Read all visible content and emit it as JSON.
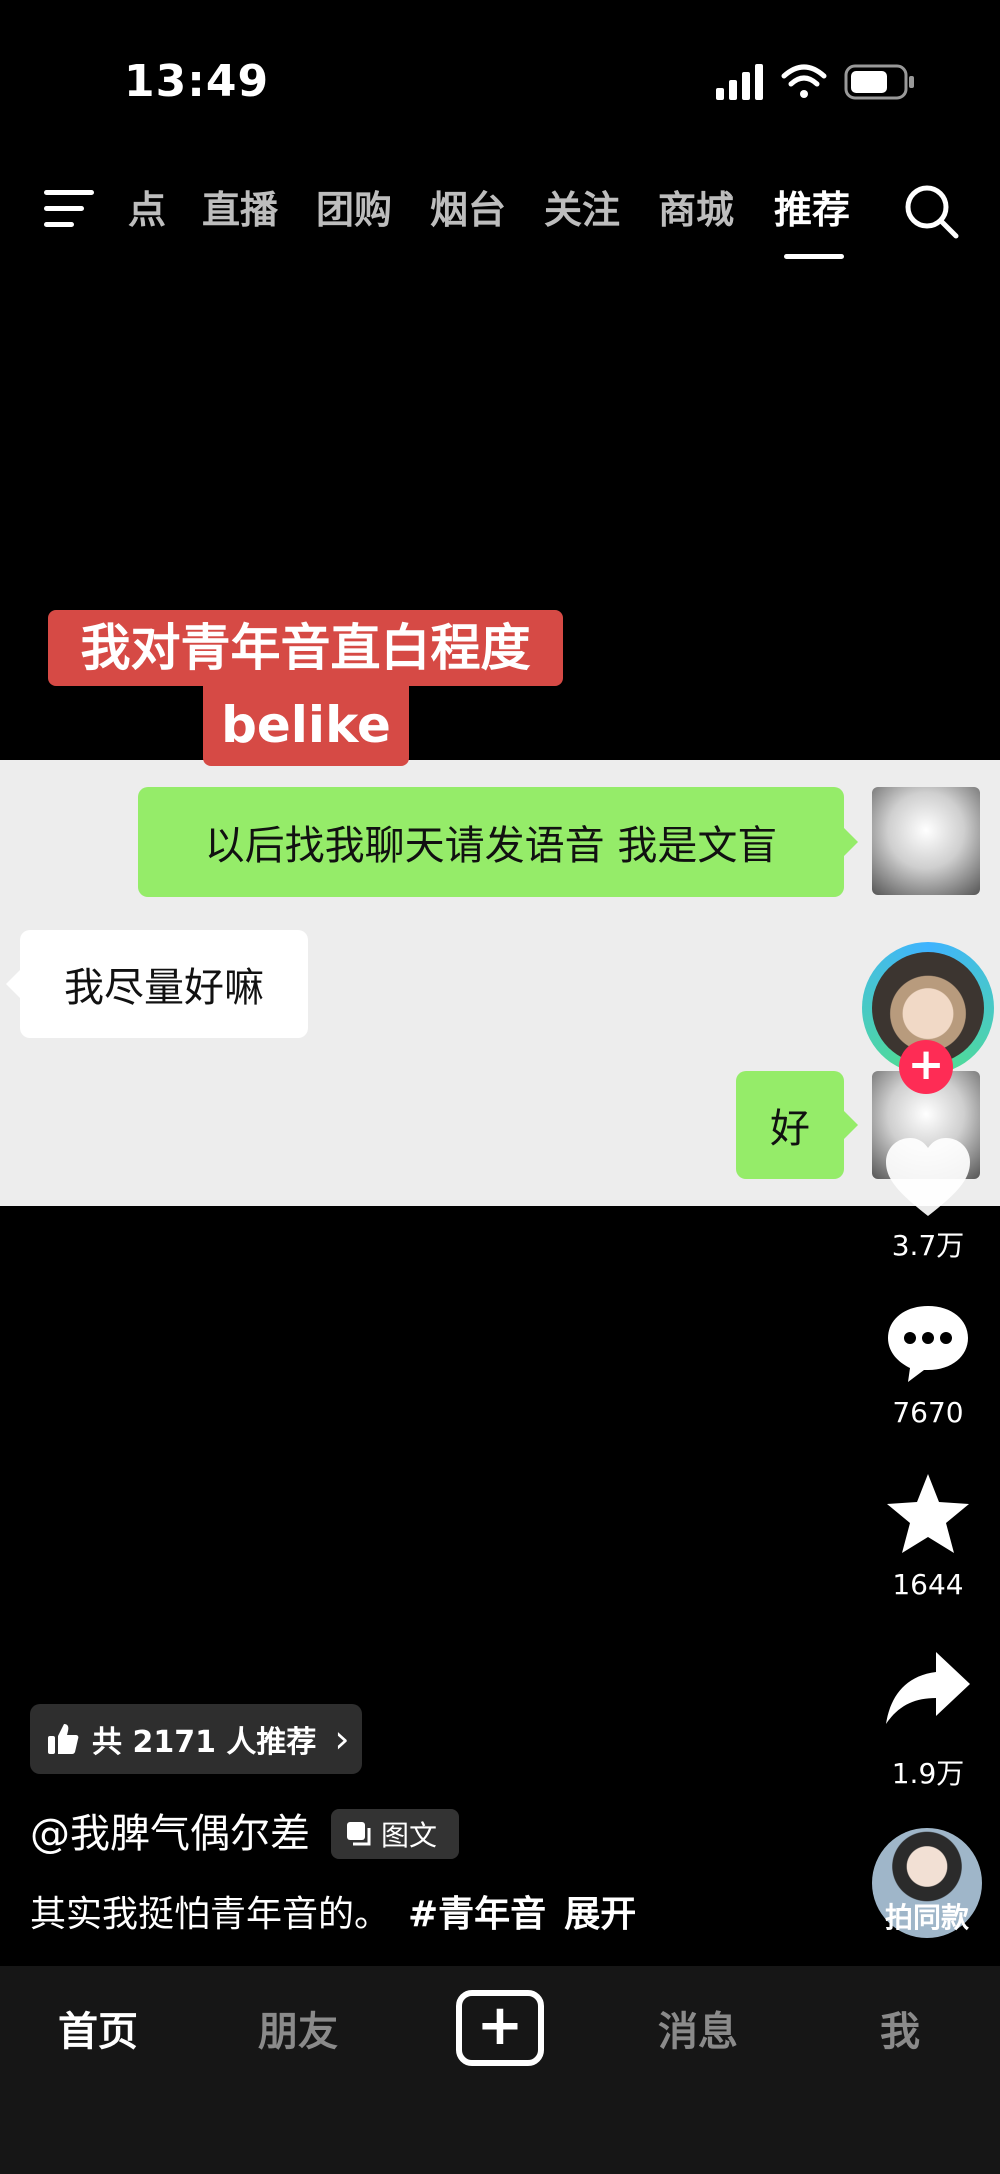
{
  "status_bar": {
    "time": "13:49"
  },
  "top_nav": {
    "tabs": [
      {
        "label": "点"
      },
      {
        "label": "直播"
      },
      {
        "label": "团购"
      },
      {
        "label": "烟台"
      },
      {
        "label": "关注"
      },
      {
        "label": "商城"
      },
      {
        "label": "推荐",
        "active": true
      }
    ]
  },
  "caption": {
    "line1": "我对青年音直白程度",
    "line2": "belike"
  },
  "chat": {
    "messages": [
      {
        "side": "right",
        "text": "以后找我聊天请发语音 我是文盲"
      },
      {
        "side": "left",
        "text": "我尽量好嘛"
      },
      {
        "side": "right",
        "text": "好"
      }
    ]
  },
  "actions": {
    "likes": "3.7万",
    "comments": "7670",
    "favorites": "1644",
    "shares": "1.9万",
    "follow_symbol": "+"
  },
  "recommend": {
    "text": "共 2171 人推荐",
    "chevron": "›"
  },
  "author": {
    "name": "@我脾气偶尔差",
    "post_type": "图文"
  },
  "description": {
    "text": "其实我挺怕青年音的。",
    "hashtag": "#青年音",
    "expand": "展开"
  },
  "music": {
    "label": "拍同款"
  },
  "bottom_nav": {
    "home": "首页",
    "friends": "朋友",
    "create": "+",
    "messages": "消息",
    "me": "我"
  },
  "colors": {
    "background": "#000000",
    "caption_bg": "#d64a45",
    "bubble_green": "#95ec69",
    "chat_bg": "#ededed",
    "follow_red": "#fe2c55"
  },
  "icons": [
    "menu-icon",
    "search-icon",
    "heart-icon",
    "comment-icon",
    "star-icon",
    "share-icon",
    "thumbs-up-icon",
    "images-icon",
    "plus-icon"
  ]
}
